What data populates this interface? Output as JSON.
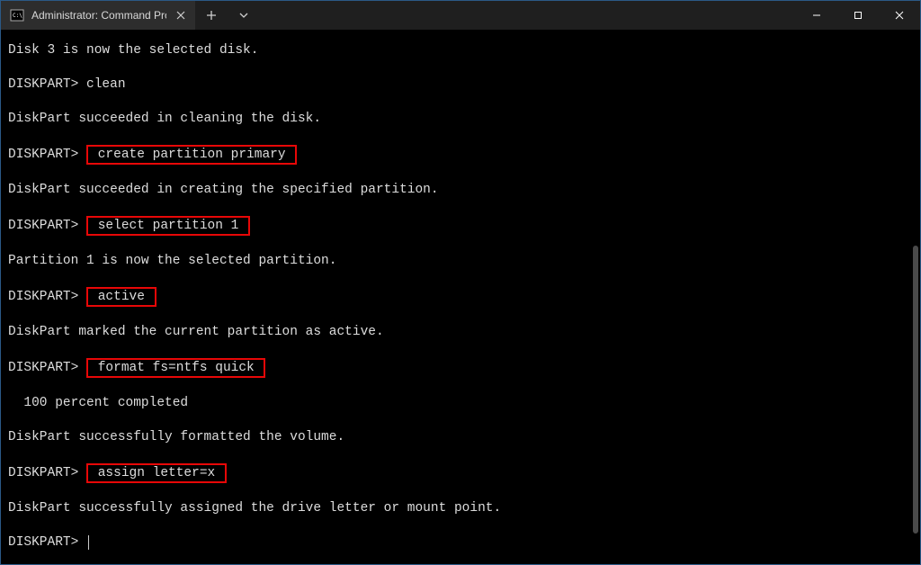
{
  "window": {
    "title": "Administrator: Command Promp"
  },
  "terminal": {
    "prompt": "DISKPART>",
    "lines": [
      {
        "type": "text",
        "text": "Disk 3 is now the selected disk."
      },
      {
        "type": "blank"
      },
      {
        "type": "cmd",
        "prompt": "DISKPART>",
        "command": "clean",
        "highlight": false
      },
      {
        "type": "blank"
      },
      {
        "type": "text",
        "text": "DiskPart succeeded in cleaning the disk."
      },
      {
        "type": "blank"
      },
      {
        "type": "cmd",
        "prompt": "DISKPART>",
        "command": "create partition primary",
        "highlight": true
      },
      {
        "type": "blank"
      },
      {
        "type": "text",
        "text": "DiskPart succeeded in creating the specified partition."
      },
      {
        "type": "blank"
      },
      {
        "type": "cmd",
        "prompt": "DISKPART>",
        "command": "select partition 1",
        "highlight": true
      },
      {
        "type": "blank"
      },
      {
        "type": "text",
        "text": "Partition 1 is now the selected partition."
      },
      {
        "type": "blank"
      },
      {
        "type": "cmd",
        "prompt": "DISKPART>",
        "command": "active",
        "highlight": true
      },
      {
        "type": "blank"
      },
      {
        "type": "text",
        "text": "DiskPart marked the current partition as active."
      },
      {
        "type": "blank"
      },
      {
        "type": "cmd",
        "prompt": "DISKPART>",
        "command": "format fs=ntfs quick",
        "highlight": true
      },
      {
        "type": "blank"
      },
      {
        "type": "text",
        "text": "  100 percent completed"
      },
      {
        "type": "blank"
      },
      {
        "type": "text",
        "text": "DiskPart successfully formatted the volume."
      },
      {
        "type": "blank"
      },
      {
        "type": "cmd",
        "prompt": "DISKPART>",
        "command": "assign letter=x",
        "highlight": true
      },
      {
        "type": "blank"
      },
      {
        "type": "text",
        "text": "DiskPart successfully assigned the drive letter or mount point."
      },
      {
        "type": "blank"
      },
      {
        "type": "cmd",
        "prompt": "DISKPART>",
        "command": "",
        "highlight": false,
        "cursor": true
      }
    ]
  }
}
